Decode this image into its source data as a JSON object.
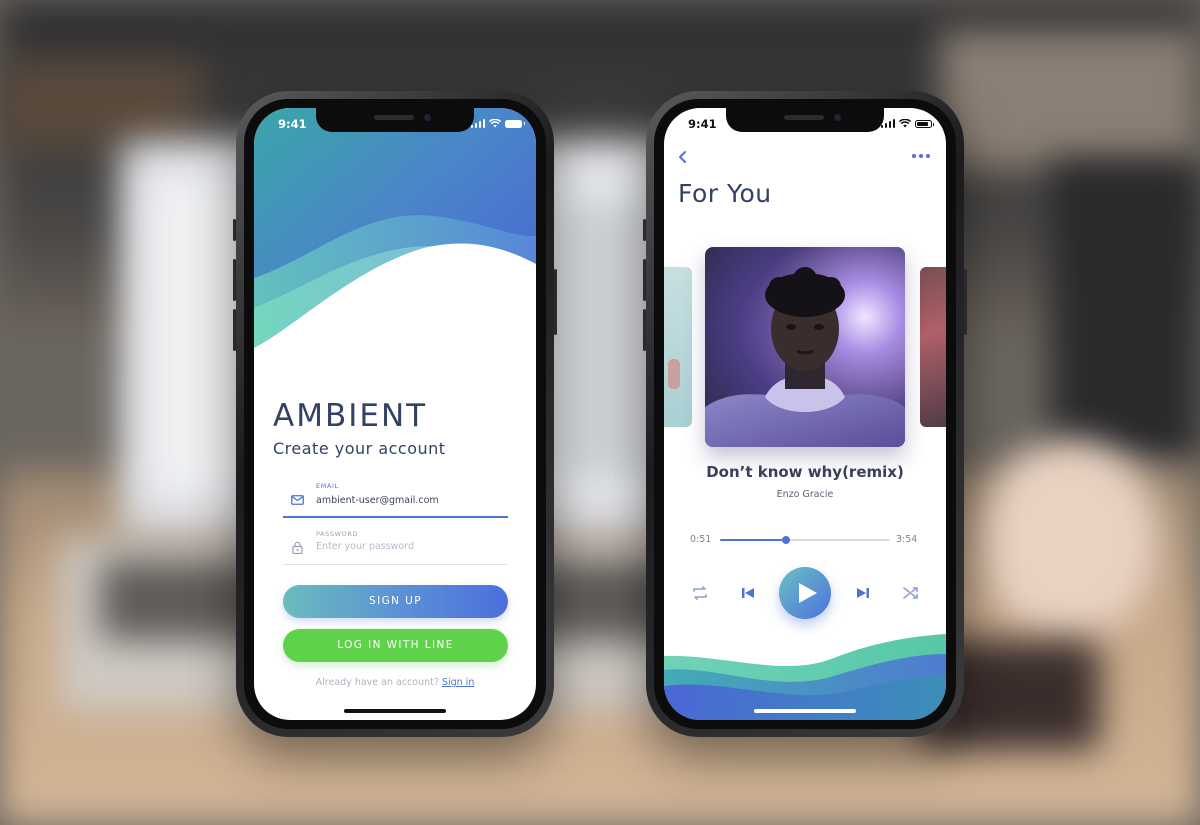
{
  "colors": {
    "accent_blue": "#4f73d4",
    "line_green": "#5fd24c",
    "wave_teal": "#6fd2b8",
    "title_navy": "#334163"
  },
  "signup_screen": {
    "status_time": "9:41",
    "app_name": "AMBIENT",
    "subtitle": "Create your account",
    "email": {
      "label": "EMAIL",
      "value": "ambient-user@gmail.com",
      "icon": "mail-icon"
    },
    "password": {
      "label": "PASSWORD",
      "placeholder": "Enter your password",
      "icon": "lock-icon"
    },
    "signup_button": "SIGN UP",
    "line_button": "LOG IN WITH LINE",
    "already_text": "Already have an account?",
    "signin_link": "Sign in"
  },
  "player_screen": {
    "status_time": "9:41",
    "page_title": "For You",
    "song_title": "Don’t know why(remix)",
    "artist": "Enzo Gracie",
    "elapsed": "0:51",
    "duration": "3:54",
    "progress": 0.39,
    "controls": [
      "repeat-icon",
      "skip-previous-icon",
      "play-icon",
      "skip-next-icon",
      "shuffle-icon"
    ]
  }
}
